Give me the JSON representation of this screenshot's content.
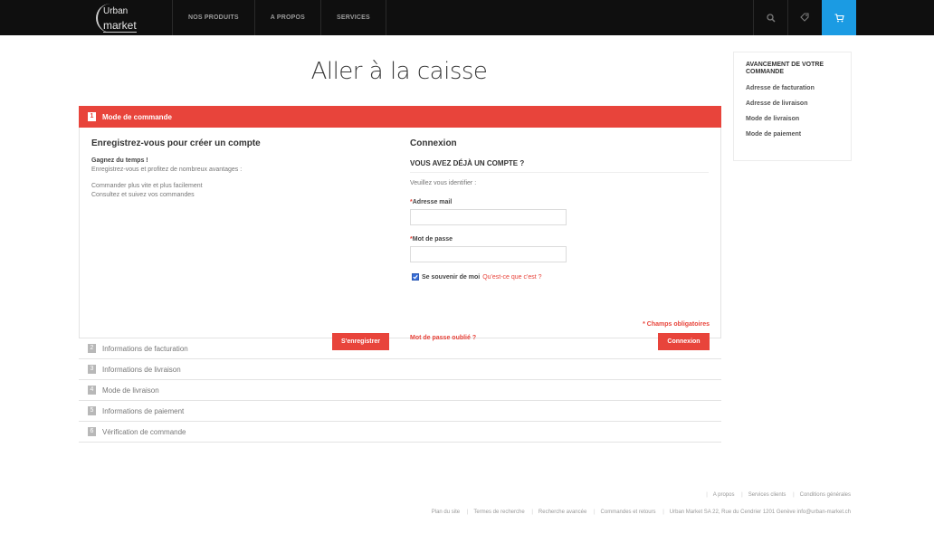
{
  "header": {
    "logo": {
      "line1": "Urban",
      "line2": "market"
    },
    "nav": [
      "NOS PRODUITS",
      "A PROPOS",
      "SERVICES"
    ],
    "icons": [
      "search-icon",
      "tag-icon",
      "cart-icon"
    ],
    "accent": "#1b9be3"
  },
  "page": {
    "title": "Aller à la caisse"
  },
  "checkout": {
    "active_step": {
      "num": "1",
      "label": "Mode de commande"
    },
    "register": {
      "heading": "Enregistrez-vous pour créer un compte",
      "line1": "Gagnez du temps !",
      "line2": "Enregistrez-vous et profitez de nombreux avantages :",
      "line3": "Commander plus vite et plus facilement",
      "line4": "Consultez et suivez vos commandes",
      "button": "S'enregistrer"
    },
    "login": {
      "heading": "Connexion",
      "subheading": "VOUS AVEZ DÉJÀ UN COMPTE ?",
      "hint": "Veuillez vous identifier :",
      "email_label": "Adresse mail",
      "password_label": "Mot de passe",
      "required_mark": "*",
      "email_value": "",
      "password_value": "",
      "remember_label": "Se souvenir de moi",
      "remember_link": "Qu'est-ce que c'est ?",
      "required_note": "* Champs obligatoires",
      "forgot": "Mot de passe oublié ?",
      "button": "Connexion"
    },
    "steps": [
      {
        "num": "2",
        "label": "Informations de facturation"
      },
      {
        "num": "3",
        "label": "Informations de livraison"
      },
      {
        "num": "4",
        "label": "Mode de livraison"
      },
      {
        "num": "5",
        "label": "Informations de paiement"
      },
      {
        "num": "6",
        "label": "Vérification de commande"
      }
    ],
    "accent": "#e8443b"
  },
  "sidebar": {
    "title": "AVANCEMENT DE VOTRE COMMANDE",
    "items": [
      "Adresse de facturation",
      "Adresse de livraison",
      "Mode de livraison",
      "Mode de paiement"
    ]
  },
  "footer": {
    "row1": [
      "A propos",
      "Services clients",
      "Conditions générales"
    ],
    "row2": [
      "Plan du site",
      "Termes de recherche",
      "Recherche avancée",
      "Commandes et retours"
    ],
    "address": "Urban Market SA 22, Rue du Cendrier 1201 Genève info@urban-market.ch"
  }
}
